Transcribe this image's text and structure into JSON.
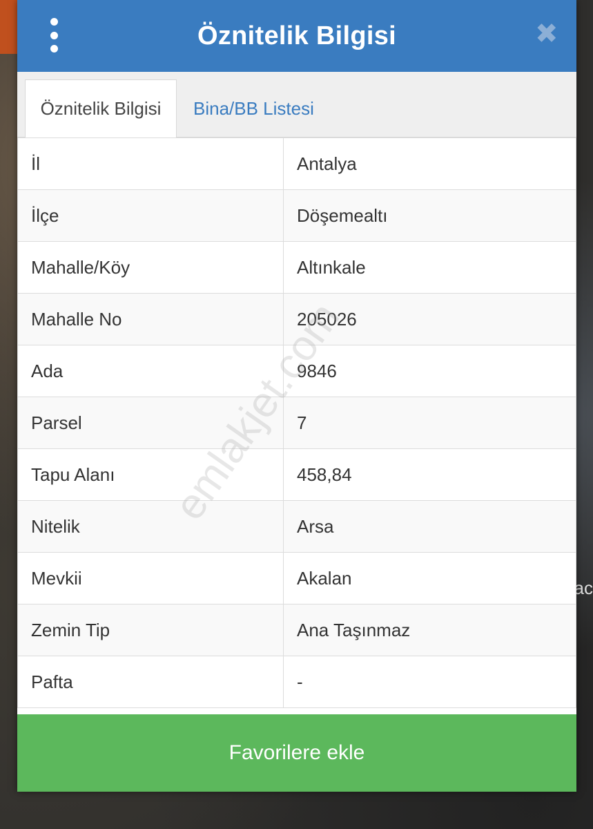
{
  "header": {
    "title": "Öznitelik Bilgisi"
  },
  "tabs": [
    {
      "label": "Öznitelik Bilgisi",
      "active": true
    },
    {
      "label": "Bina/BB Listesi",
      "active": false
    }
  ],
  "rows": [
    {
      "key": "İl",
      "value": "Antalya"
    },
    {
      "key": "İlçe",
      "value": "Döşemealtı"
    },
    {
      "key": "Mahalle/Köy",
      "value": "Altınkale"
    },
    {
      "key": "Mahalle No",
      "value": "205026"
    },
    {
      "key": "Ada",
      "value": "9846"
    },
    {
      "key": "Parsel",
      "value": "7"
    },
    {
      "key": "Tapu Alanı",
      "value": "458,84"
    },
    {
      "key": "Nitelik",
      "value": "Arsa"
    },
    {
      "key": "Mevkii",
      "value": "Akalan"
    },
    {
      "key": "Zemin Tip",
      "value": "Ana Taşınmaz"
    },
    {
      "key": "Pafta",
      "value": "-"
    }
  ],
  "footer": {
    "favorite_label": "Favorilere ekle"
  },
  "watermark": "emlakjet.com",
  "background_text": "ac",
  "colors": {
    "header": "#3a7cc0",
    "button": "#5cb85c",
    "tab_link": "#3a7cc0"
  }
}
